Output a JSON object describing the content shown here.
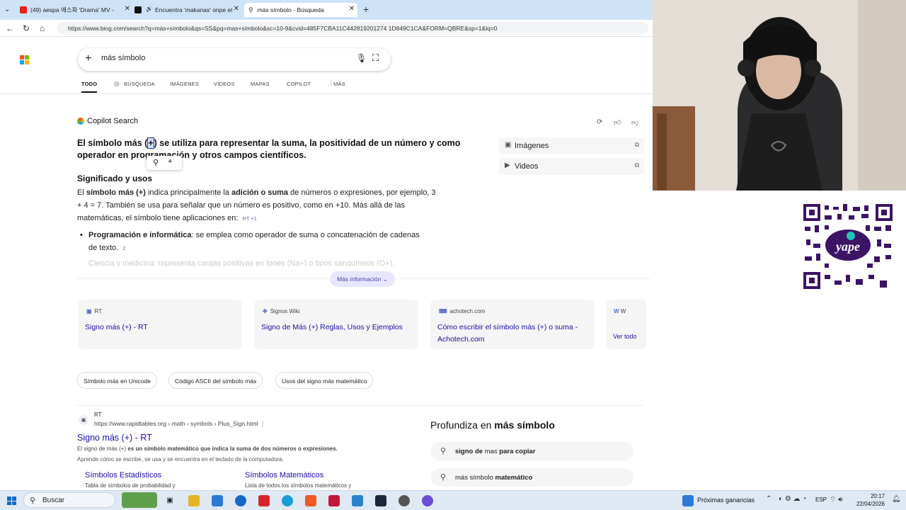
{
  "browser": {
    "tabs": [
      {
        "label": "(49) aespa 에스파 'Drama' MV -"
      },
      {
        "label": "Encuentra 'makanas' onpe el"
      },
      {
        "label": "más símbolo - Búsqueda"
      }
    ],
    "new_tab": "+",
    "url": "https://www.bing.com/search?q=más+símbolo&qs=SS&pq=mas+símbolo&sc=10-9&cvid=485F7CBA11C442819201274 1D849C1CA&FORM=QBRE&sp=1&lq=0"
  },
  "bing": {
    "search_value": "más símbolo",
    "nav_tabs": [
      "TODO",
      "BÚSQUEDA",
      "IMÁGENES",
      "VIDEOS",
      "MAPAS",
      "COPILOT",
      "MÁS"
    ],
    "copilot_label": "Copilot Search",
    "answer_head_pre": "El símbolo más (",
    "answer_head_mark": "+",
    "answer_head_post": ") se utiliza para representar la suma, la positividad de un número y como operador en programación y otros campos científicos.",
    "section_title": "Significado y usos",
    "para_1": "El ",
    "para_bold_1": "símbolo más (+)",
    "para_2": " indica principalmente la ",
    "para_bold_2": "adición o suma",
    "para_3": " de números o expresiones, por ejemplo, 3 + 4 = 7. También se usa para señalar que un número es positivo, como en +10. Más allá de las matemáticas, el símbolo tiene aplicaciones en:",
    "para_cite": "RT  +1",
    "bullet_bold": "Programación e informática",
    "bullet_text": ": se emplea como operador de suma o concatenación de cadenas de texto.",
    "bullet_cite": "2",
    "faded_line": "Ciencia y medicina: representa cargas positivas en iones (Na+) o tipos sanguíneos (O+).",
    "more_info": "Más información",
    "side_boxes": [
      "Imágenes",
      "Videos"
    ],
    "cards": [
      {
        "source": "RT",
        "title": "Signo más (+) - RT"
      },
      {
        "source": "Signos Wiki",
        "title": "Signo de Más (+) Reglas, Usos y Ejemplos"
      },
      {
        "source": "achotech.com",
        "title": "Cómo escribir el símbolo más (+) o suma - Achotech.com"
      }
    ],
    "card4_source": "W",
    "see_all": "Ver todo",
    "chips": [
      "Símbolo más en Unicode",
      "Código ASCII del símbolo más",
      "Usos del signo más matemático"
    ],
    "result": {
      "site": "RT",
      "url": "https://www.rapidtables.org › math › symbols › Plus_Sign.html",
      "title": "Signo más (+) - RT",
      "snippet_1_pre": "El signo de más (+) ",
      "snippet_1_bold": "es un símbolo matemático que indica la suma de dos números o expresiones.",
      "snippet_2": "Aprende cómo se escribe, se usa y se encuentra en el teclado de la computadora.",
      "sublinks": [
        {
          "title": "Símbolos Estadísticos",
          "desc": "Tabla de símbolos de probabilidad y"
        },
        {
          "title": "Símbolos Matemáticos",
          "desc": "Lista de todos los símbolos matemáticos y"
        }
      ]
    },
    "profundiza_pre": "Profundiza en ",
    "profundiza_bold": "más símbolo",
    "related": [
      {
        "bold": "signo de",
        "normal": " mas ",
        "bold2": "para copiar"
      },
      {
        "bold": "",
        "normal": "más símbolo ",
        "bold2": "matemático"
      }
    ]
  },
  "taskbar": {
    "search_placeholder": "Buscar",
    "weather": "Próximas ganancias",
    "lang": "ESP",
    "time": "20:17",
    "date": "22/04/2026"
  },
  "colors": {
    "accent": "#1a0dab",
    "copilot_purple": "#4a3fb0",
    "tabbar_bg": "#cfe3f7"
  }
}
